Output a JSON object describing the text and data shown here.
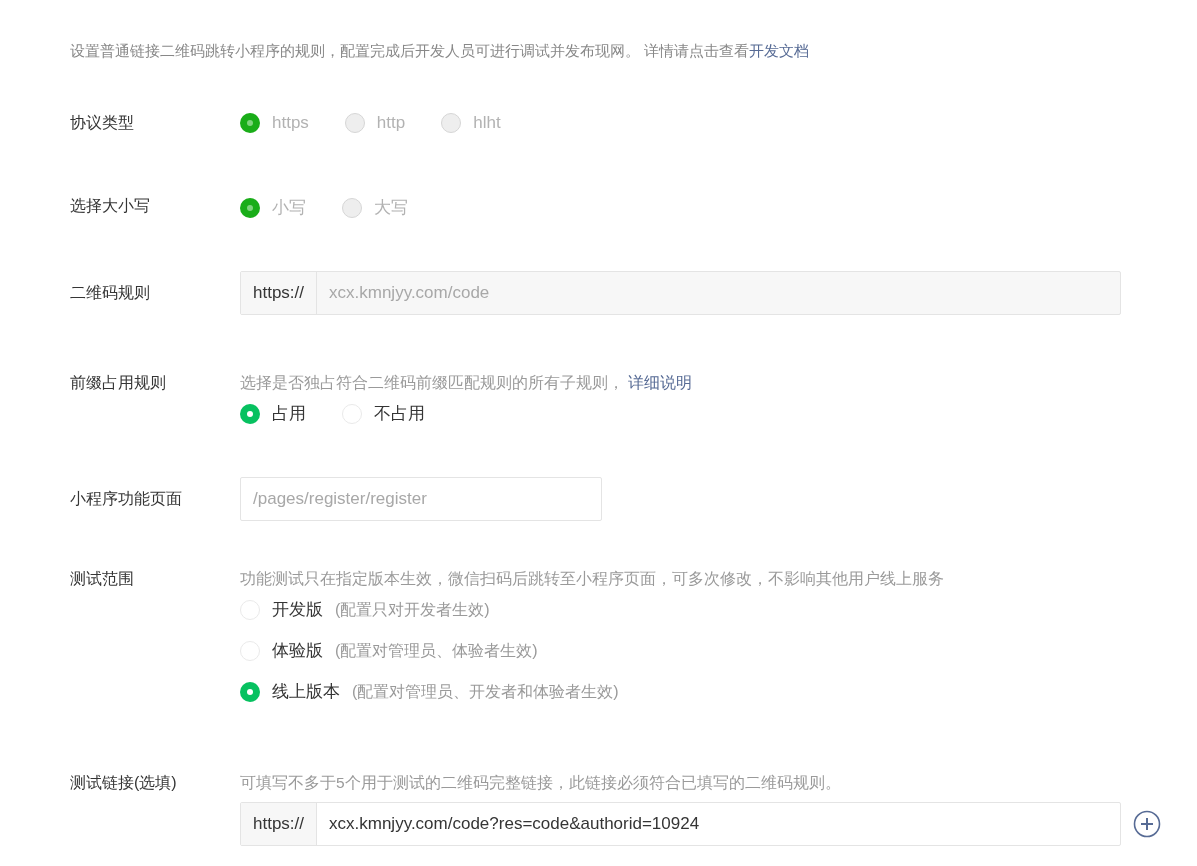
{
  "intro": {
    "text": "设置普通链接二维码跳转小程序的规则，配置完成后开发人员可进行调试并发布现网。 详情请点击查看",
    "link": "开发文档"
  },
  "rows": [
    {
      "kind": "radios",
      "label": "协议类型",
      "disabled": true,
      "options": [
        {
          "label": "https",
          "selected": true
        },
        {
          "label": "http",
          "selected": false
        },
        {
          "label": "hlht",
          "selected": false
        }
      ]
    },
    {
      "kind": "radios",
      "label": "选择大小写",
      "disabled": true,
      "options": [
        {
          "label": "小写",
          "selected": true
        },
        {
          "label": "大写",
          "selected": false
        }
      ]
    },
    {
      "kind": "prefixed",
      "label": "二维码规则",
      "prefix": "https://",
      "placeholder": "xcx.kmnjyy.com/code"
    },
    {
      "kind": "radios",
      "label": "前缀占用规则",
      "disabled": false,
      "hint": "选择是否独占符合二维码前缀匹配规则的所有子规则，",
      "hint_link": "详细说明",
      "options": [
        {
          "label": "占用",
          "selected": true
        },
        {
          "label": "不占用",
          "selected": false
        }
      ]
    },
    {
      "kind": "input",
      "label": "小程序功能页面",
      "placeholder": "/pages/register/register"
    },
    {
      "kind": "radios",
      "label": "测试范围",
      "disabled": false,
      "vertical": true,
      "hint": "功能测试只在指定版本生效，微信扫码后跳转至小程序页面，可多次修改，不影响其他用户线上服务",
      "options": [
        {
          "label": "开发版",
          "note": "(配置只对开发者生效)",
          "selected": false
        },
        {
          "label": "体验版",
          "note": "(配置对管理员、体验者生效)",
          "selected": false
        },
        {
          "label": "线上版本",
          "note": "(配置对管理员、开发者和体验者生效)",
          "selected": true
        }
      ]
    },
    {
      "kind": "prefixed",
      "label": "测试链接(选填)",
      "hint": "可填写不多于5个用于测试的二维码完整链接，此链接必须符合已填写的二维码规则。",
      "prefix": "https://",
      "value": "xcx.kmnjyy.com/code?res=code&authorid=10924",
      "addable": true
    }
  ]
}
